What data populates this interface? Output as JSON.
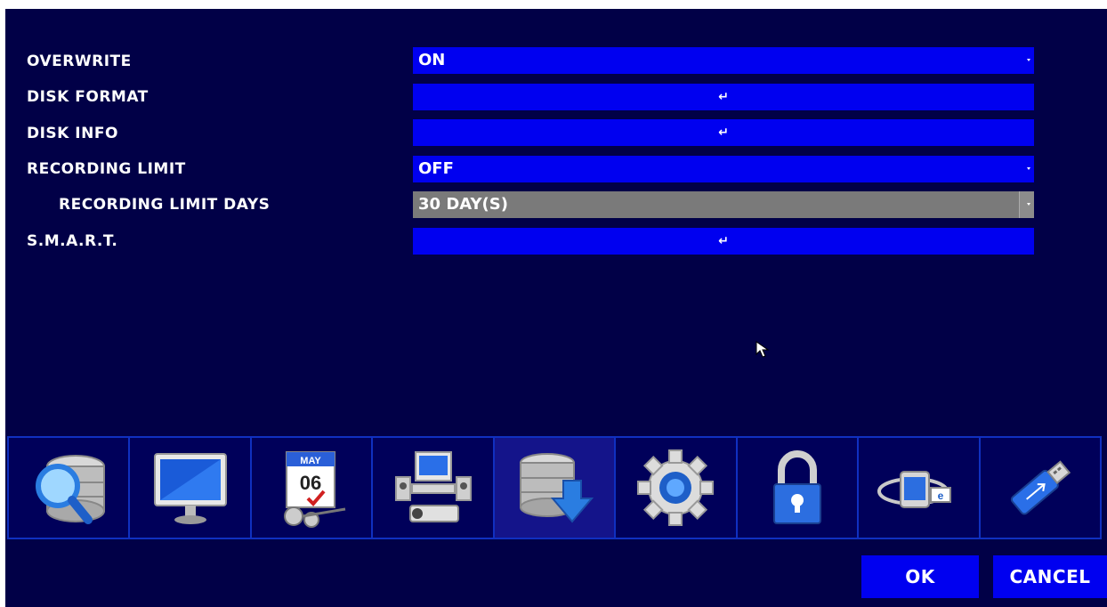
{
  "settings": [
    {
      "label": "OVERWRITE",
      "value": "ON",
      "type": "dropdown"
    },
    {
      "label": "DISK FORMAT",
      "value": "",
      "type": "enter"
    },
    {
      "label": "DISK INFO",
      "value": "",
      "type": "enter"
    },
    {
      "label": "RECORDING LIMIT",
      "value": "OFF",
      "type": "dropdown"
    },
    {
      "label": "RECORDING LIMIT DAYS",
      "value": "30 DAY(S)",
      "type": "dropdown-disabled"
    },
    {
      "label": "S.M.A.R.T.",
      "value": "",
      "type": "enter"
    }
  ],
  "enter_glyph": "↵",
  "toolbar": {
    "icons": [
      "search-disk-icon",
      "monitor-icon",
      "calendar-schedule-icon",
      "network-computer-icon",
      "storage-download-icon",
      "gear-icon",
      "lock-icon",
      "network-globe-icon",
      "usb-drive-icon"
    ],
    "calendar_month": "MAY",
    "calendar_day": "06"
  },
  "buttons": {
    "ok": "OK",
    "cancel": "CANCEL"
  },
  "colors": {
    "background": "#010047",
    "field": "#0000f0",
    "disabled": "#7a7a7a",
    "active_tab": "#14148a"
  }
}
